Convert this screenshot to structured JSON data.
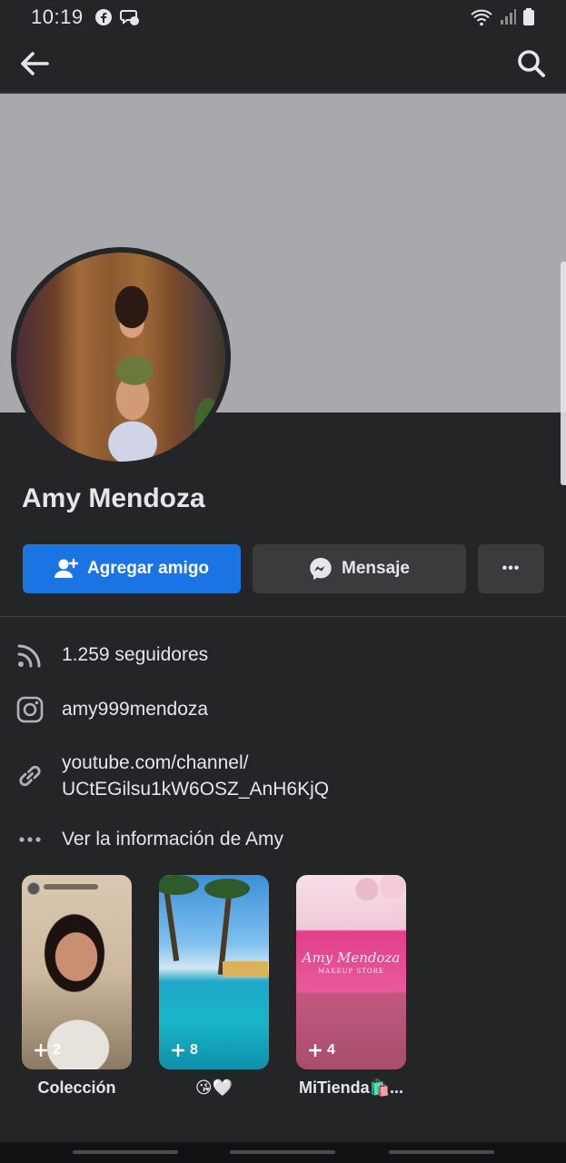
{
  "status_bar": {
    "time": "10:19"
  },
  "app_bar": {
    "back_icon": "arrow-left-icon",
    "search_icon": "search-icon"
  },
  "profile": {
    "name": "Amy Mendoza"
  },
  "actions": {
    "add_friend": "Agregar amigo",
    "message": "Mensaje",
    "more": "•••"
  },
  "info": {
    "followers": "1.259 seguidores",
    "instagram": "amy999mendoza",
    "link_line1": "youtube.com/channel/",
    "link_line2": "UCtEGilsu1kW6OSZ_AnH6KjQ",
    "see_info": "Ver la información de Amy"
  },
  "featured": [
    {
      "count": "2",
      "label": "Colección"
    },
    {
      "count": "8",
      "label": "😘🤍"
    },
    {
      "count": "4",
      "label": "MiTienda🛍️..."
    }
  ],
  "featured_card3_text": {
    "title": "Amy Mendoza",
    "subtitle": "MAKEUP STORE"
  },
  "colors": {
    "accent": "#1b74e4",
    "background": "#242526",
    "button_secondary": "#3a3b3c",
    "cover": "#a7a9ad"
  }
}
